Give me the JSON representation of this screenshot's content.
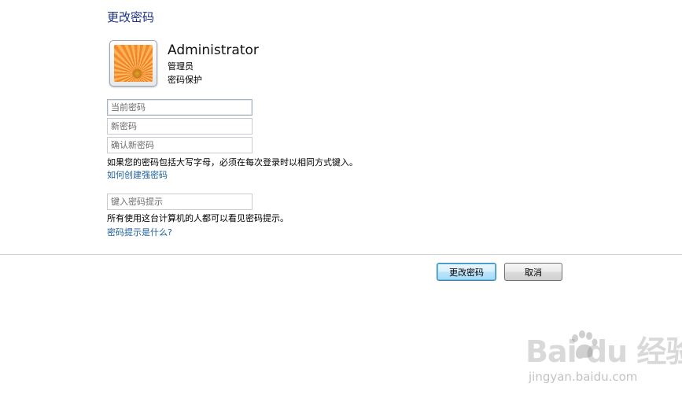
{
  "page": {
    "title": "更改密码"
  },
  "user": {
    "name": "Administrator",
    "role": "管理员",
    "protection": "密码保护"
  },
  "form": {
    "current_password_placeholder": "当前密码",
    "new_password_placeholder": "新密码",
    "confirm_password_placeholder": "确认新密码",
    "caps_note": "如果您的密码包括大写字母，必须在每次登录时以相同方式键入。",
    "strong_password_link": "如何创建强密码",
    "hint_placeholder": "键入密码提示",
    "hint_note": "所有使用这台计算机的人都可以看见密码提示。",
    "hint_link": "密码提示是什么?"
  },
  "buttons": {
    "change": "更改密码",
    "cancel": "取消"
  },
  "watermark": {
    "brand": "Bai du 经验",
    "url": "jingyan.baidu.com"
  }
}
